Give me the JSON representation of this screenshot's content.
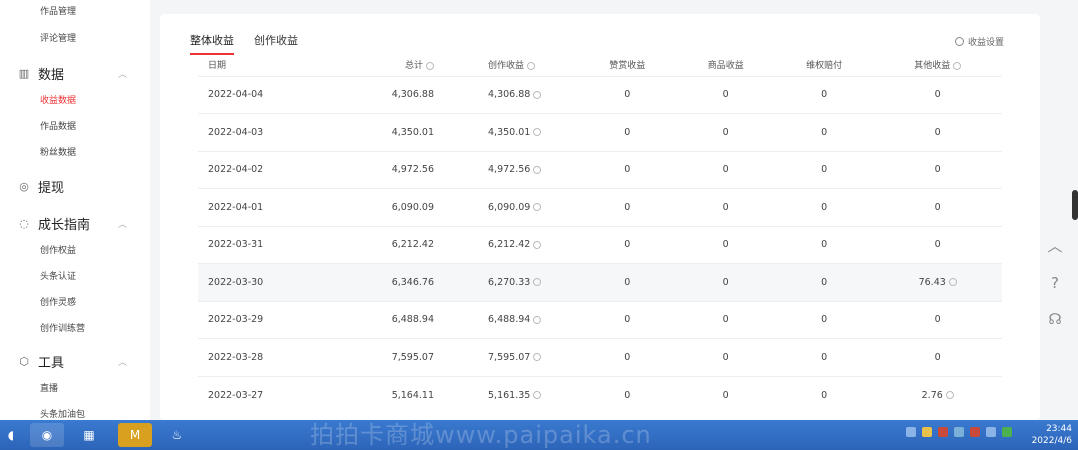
{
  "sidebar": {
    "items": [
      {
        "type": "sub",
        "label": "作品管理"
      },
      {
        "type": "sub",
        "label": "评论管理"
      },
      {
        "type": "group",
        "label": "数据",
        "icon": "bar-chart-icon"
      },
      {
        "type": "sub",
        "label": "收益数据",
        "active": true
      },
      {
        "type": "sub",
        "label": "作品数据"
      },
      {
        "type": "sub",
        "label": "粉丝数据"
      },
      {
        "type": "group",
        "label": "提现",
        "icon": "withdraw-icon"
      },
      {
        "type": "group",
        "label": "成长指南",
        "icon": "growth-icon"
      },
      {
        "type": "sub",
        "label": "创作权益"
      },
      {
        "type": "sub",
        "label": "头条认证"
      },
      {
        "type": "sub",
        "label": "创作灵感"
      },
      {
        "type": "sub",
        "label": "创作训练营"
      },
      {
        "type": "group",
        "label": "工具",
        "icon": "tools-icon"
      },
      {
        "type": "sub",
        "label": "直播"
      },
      {
        "type": "sub",
        "label": "头条加油包"
      }
    ]
  },
  "tabs": [
    {
      "label": "整体收益",
      "active": true
    },
    {
      "label": "创作收益",
      "active": false
    }
  ],
  "settings_label": "收益设置",
  "table": {
    "headers": {
      "date": "日期",
      "total": "总计",
      "create": "创作收益",
      "reward": "赞赏收益",
      "goods": "商品收益",
      "rights": "维权赔付",
      "other": "其他收益"
    },
    "rows": [
      {
        "date": "2022-04-04",
        "total": "4,306.88",
        "create": "4,306.88",
        "reward": "0",
        "goods": "0",
        "rights": "0",
        "other": "0"
      },
      {
        "date": "2022-04-03",
        "total": "4,350.01",
        "create": "4,350.01",
        "reward": "0",
        "goods": "0",
        "rights": "0",
        "other": "0"
      },
      {
        "date": "2022-04-02",
        "total": "4,972.56",
        "create": "4,972.56",
        "reward": "0",
        "goods": "0",
        "rights": "0",
        "other": "0"
      },
      {
        "date": "2022-04-01",
        "total": "6,090.09",
        "create": "6,090.09",
        "reward": "0",
        "goods": "0",
        "rights": "0",
        "other": "0"
      },
      {
        "date": "2022-03-31",
        "total": "6,212.42",
        "create": "6,212.42",
        "reward": "0",
        "goods": "0",
        "rights": "0",
        "other": "0"
      },
      {
        "date": "2022-03-30",
        "total": "6,346.76",
        "create": "6,270.33",
        "reward": "0",
        "goods": "0",
        "rights": "0",
        "other": "76.43"
      },
      {
        "date": "2022-03-29",
        "total": "6,488.94",
        "create": "6,488.94",
        "reward": "0",
        "goods": "0",
        "rights": "0",
        "other": "0"
      },
      {
        "date": "2022-03-28",
        "total": "7,595.07",
        "create": "7,595.07",
        "reward": "0",
        "goods": "0",
        "rights": "0",
        "other": "0"
      },
      {
        "date": "2022-03-27",
        "total": "5,164.11",
        "create": "5,161.35",
        "reward": "0",
        "goods": "0",
        "rights": "0",
        "other": "2.76"
      }
    ]
  },
  "taskbar": {
    "watermark": "拍拍卡商城www.paipaika.cn",
    "time": "23:44",
    "date": "2022/4/6"
  }
}
